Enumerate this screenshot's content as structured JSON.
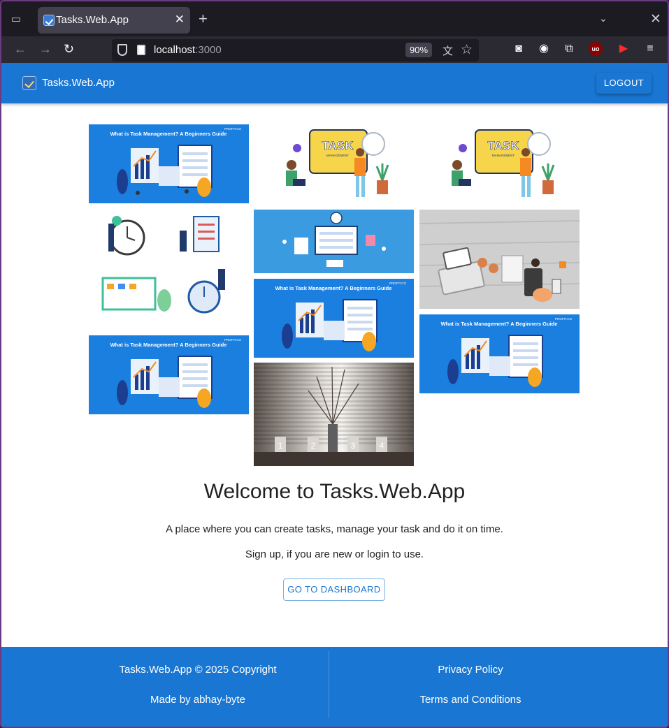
{
  "browser": {
    "tab_title": "Tasks.Web.App",
    "url_host": "localhost",
    "url_port": ":3000",
    "zoom": "90%"
  },
  "appbar": {
    "title": "Tasks.Web.App",
    "logout_label": "LOGOUT"
  },
  "gallery": {
    "banner_caption": "What is Task Management? A Beginners Guide",
    "banner_brand": "PROFIT.CO",
    "task_sign": "TASK",
    "task_sign_sub": "MANAGEMENT",
    "candle_numbers": [
      "1",
      "2",
      "3",
      "4"
    ]
  },
  "hero": {
    "heading": "Welcome to Tasks.Web.App",
    "line1": "A place where you can create tasks, manage your task and do it on time.",
    "line2": "Sign up, if you are new or login to use.",
    "dashboard_label": "GO TO DASHBOARD"
  },
  "footer": {
    "copyright": "Tasks.Web.App © 2025 Copyright",
    "made_by": "Made by abhay-byte",
    "privacy": "Privacy Policy",
    "terms": "Terms and Conditions"
  },
  "colors": {
    "primary": "#1976d2",
    "browser_bg": "#1c1b22",
    "toolbar_bg": "#2b2a33"
  }
}
